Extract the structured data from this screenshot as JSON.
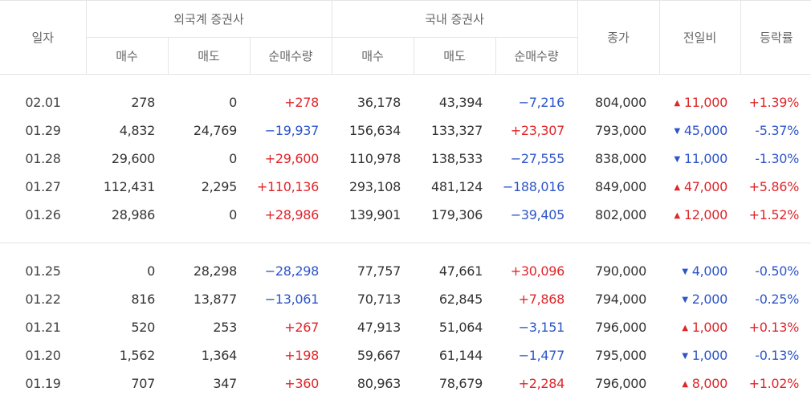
{
  "header": {
    "date": "일자",
    "foreign_group": "외국계 증권사",
    "domestic_group": "국내 증권사",
    "buy": "매수",
    "sell": "매도",
    "net": "순매수량",
    "close": "종가",
    "change": "전일비",
    "rate": "등락률"
  },
  "icons": {
    "up": "triangle-up-icon",
    "down": "triangle-down-icon"
  },
  "colors": {
    "up": "#e0262b",
    "down": "#2d55c9"
  },
  "rows": [
    {
      "date": "02.01",
      "f_buy": "278",
      "f_sell": "0",
      "f_net": "+278",
      "d_buy": "36,178",
      "d_sell": "43,394",
      "d_net": "−7,216",
      "close": "804,000",
      "dir": "up",
      "change": "11,000",
      "rate": "+1.39%"
    },
    {
      "date": "01.29",
      "f_buy": "4,832",
      "f_sell": "24,769",
      "f_net": "−19,937",
      "d_buy": "156,634",
      "d_sell": "133,327",
      "d_net": "+23,307",
      "close": "793,000",
      "dir": "down",
      "change": "45,000",
      "rate": "-5.37%"
    },
    {
      "date": "01.28",
      "f_buy": "29,600",
      "f_sell": "0",
      "f_net": "+29,600",
      "d_buy": "110,978",
      "d_sell": "138,533",
      "d_net": "−27,555",
      "close": "838,000",
      "dir": "down",
      "change": "11,000",
      "rate": "-1.30%"
    },
    {
      "date": "01.27",
      "f_buy": "112,431",
      "f_sell": "2,295",
      "f_net": "+110,136",
      "d_buy": "293,108",
      "d_sell": "481,124",
      "d_net": "−188,016",
      "close": "849,000",
      "dir": "up",
      "change": "47,000",
      "rate": "+5.86%"
    },
    {
      "date": "01.26",
      "f_buy": "28,986",
      "f_sell": "0",
      "f_net": "+28,986",
      "d_buy": "139,901",
      "d_sell": "179,306",
      "d_net": "−39,405",
      "close": "802,000",
      "dir": "up",
      "change": "12,000",
      "rate": "+1.52%"
    },
    {
      "date": "01.25",
      "f_buy": "0",
      "f_sell": "28,298",
      "f_net": "−28,298",
      "d_buy": "77,757",
      "d_sell": "47,661",
      "d_net": "+30,096",
      "close": "790,000",
      "dir": "down",
      "change": "4,000",
      "rate": "-0.50%"
    },
    {
      "date": "01.22",
      "f_buy": "816",
      "f_sell": "13,877",
      "f_net": "−13,061",
      "d_buy": "70,713",
      "d_sell": "62,845",
      "d_net": "+7,868",
      "close": "794,000",
      "dir": "down",
      "change": "2,000",
      "rate": "-0.25%"
    },
    {
      "date": "01.21",
      "f_buy": "520",
      "f_sell": "253",
      "f_net": "+267",
      "d_buy": "47,913",
      "d_sell": "51,064",
      "d_net": "−3,151",
      "close": "796,000",
      "dir": "up",
      "change": "1,000",
      "rate": "+0.13%"
    },
    {
      "date": "01.20",
      "f_buy": "1,562",
      "f_sell": "1,364",
      "f_net": "+198",
      "d_buy": "59,667",
      "d_sell": "61,144",
      "d_net": "−1,477",
      "close": "795,000",
      "dir": "down",
      "change": "1,000",
      "rate": "-0.13%"
    },
    {
      "date": "01.19",
      "f_buy": "707",
      "f_sell": "347",
      "f_net": "+360",
      "d_buy": "80,963",
      "d_sell": "78,679",
      "d_net": "+2,284",
      "close": "796,000",
      "dir": "up",
      "change": "8,000",
      "rate": "+1.02%"
    }
  ]
}
